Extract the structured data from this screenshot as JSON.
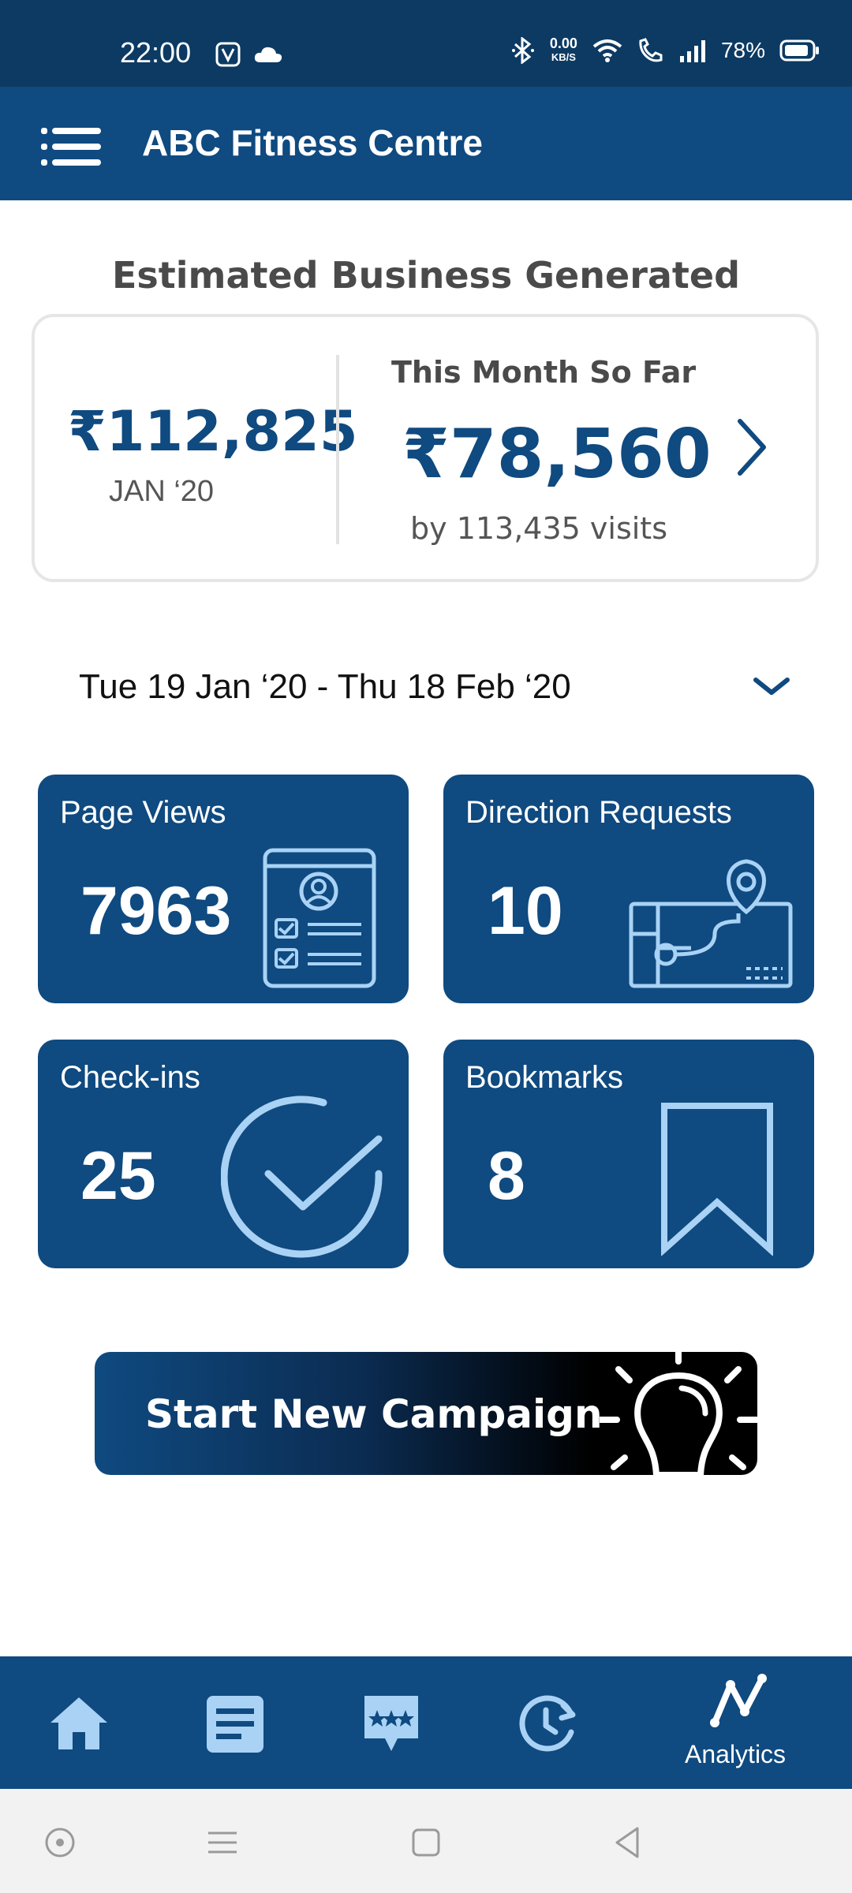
{
  "status_bar": {
    "time": "22:00",
    "net_speed_value": "0.00",
    "net_speed_unit": "KB/S",
    "battery": "78%",
    "icons": [
      "app-icon",
      "cloud-icon",
      "bluetooth-icon",
      "wifi-icon",
      "wifi-calling-icon",
      "signal-icon",
      "battery-icon"
    ]
  },
  "app_bar": {
    "title": "ABC Fitness Centre",
    "menu_icon": "hamburger-menu-icon"
  },
  "business": {
    "title": "Estimated Business Generated",
    "last_month_value": "₹112,825",
    "last_month_label": "JAN ‘20",
    "this_month_label": "This Month So Far",
    "this_month_value": "₹78,560",
    "this_month_sub": "by 113,435 visits"
  },
  "date_range": {
    "label": "Tue 19 Jan ‘20 - Thu 18 Feb ‘20"
  },
  "tiles": [
    {
      "label": "Page Views",
      "value": "7963",
      "icon": "profile-document-icon"
    },
    {
      "label": "Direction Requests",
      "value": "10",
      "icon": "map-pin-icon"
    },
    {
      "label": "Check-ins",
      "value": "25",
      "icon": "checkmark-circle-icon"
    },
    {
      "label": "Bookmarks",
      "value": "8",
      "icon": "bookmark-icon"
    }
  ],
  "campaign": {
    "label": "Start New Campaign",
    "icon": "lightbulb-icon"
  },
  "bottom_nav": {
    "items": [
      {
        "icon": "home-icon",
        "label": ""
      },
      {
        "icon": "document-icon",
        "label": ""
      },
      {
        "icon": "review-stars-icon",
        "label": ""
      },
      {
        "icon": "history-icon",
        "label": ""
      },
      {
        "icon": "analytics-icon",
        "label": "Analytics"
      }
    ],
    "active_index": 4
  },
  "colors": {
    "primary": "#0f4a80",
    "status_bar": "#0c3a63",
    "icon_light": "#a9d2f5",
    "text_dark": "#4a4a4a"
  }
}
